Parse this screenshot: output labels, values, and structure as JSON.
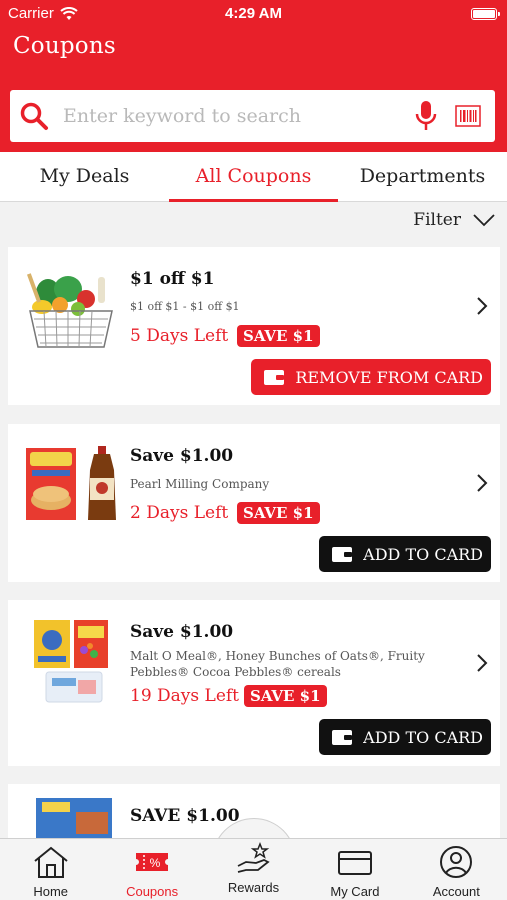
{
  "status": {
    "carrier": "Carrier",
    "time": "4:29 AM"
  },
  "header": {
    "title": "Coupons"
  },
  "search": {
    "placeholder": "Enter keyword to search"
  },
  "tabs": [
    {
      "label": "My Deals"
    },
    {
      "label": "All Coupons",
      "active": true
    },
    {
      "label": "Departments"
    }
  ],
  "filter": {
    "label": "Filter"
  },
  "coupons": [
    {
      "title": "$1 off $1",
      "description": "$1 off $1  - $1 off $1",
      "days_left": "5 Days Left",
      "badge": "SAVE $1",
      "button": "REMOVE FROM CARD",
      "image": "grocery-basket"
    },
    {
      "title": "Save $1.00",
      "description": "Pearl Milling Company",
      "days_left": "2 Days Left",
      "badge": "SAVE $1",
      "button": "ADD TO CARD",
      "image": "pancake-mix-and-syrup"
    },
    {
      "title": "Save $1.00",
      "description": "Malt O Meal®, Honey Bunches of Oats®, Fruity Pebbles® Cocoa Pebbles® cereals",
      "days_left": "19 Days Left",
      "badge": "SAVE $1",
      "button": "ADD TO CARD",
      "image": "cereal-boxes"
    },
    {
      "title": "SAVE $1.00",
      "image": "butter-package"
    }
  ],
  "nav": [
    {
      "label": "Home",
      "icon": "home-icon"
    },
    {
      "label": "Coupons",
      "icon": "coupon-icon",
      "active": true
    },
    {
      "label": "Rewards",
      "icon": "rewards-hand-star-icon"
    },
    {
      "label": "My Card",
      "icon": "card-icon"
    },
    {
      "label": "Account",
      "icon": "account-icon"
    }
  ],
  "colors": {
    "brand_red": "#e8202a",
    "button_black": "#111111"
  }
}
